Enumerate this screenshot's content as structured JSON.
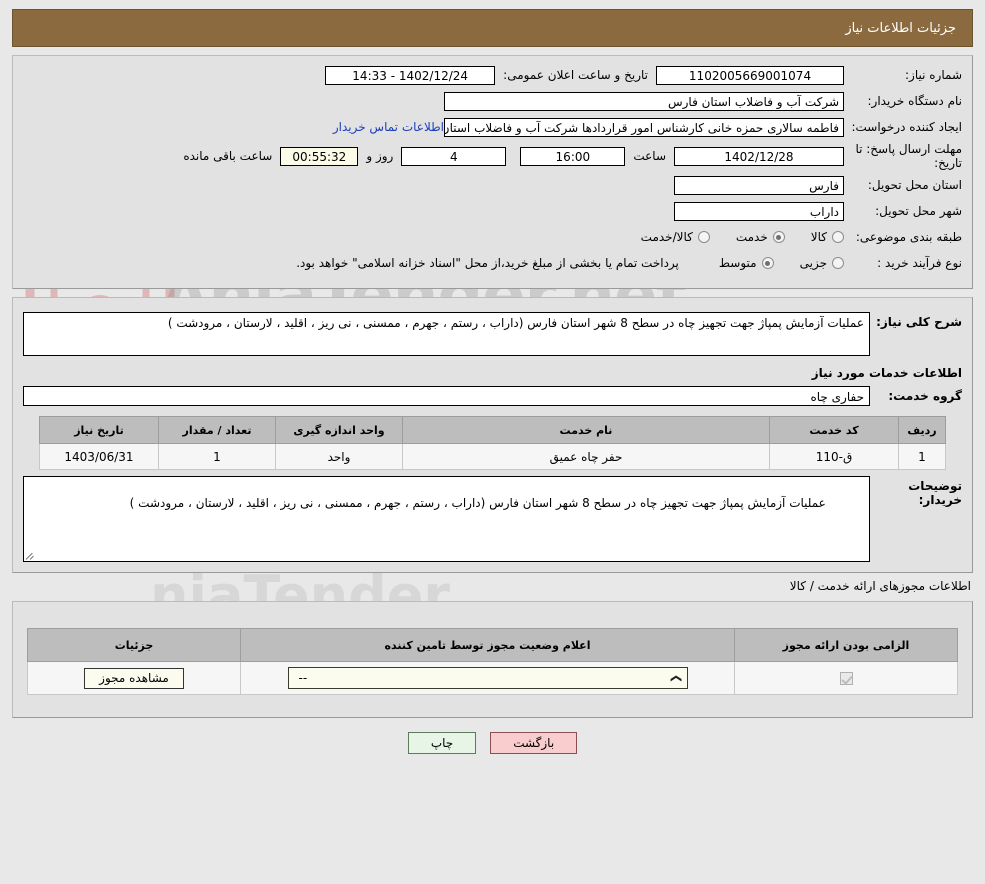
{
  "header": {
    "title": "جزئیات اطلاعات نیاز"
  },
  "main_form": {
    "need_number_label": "شماره نیاز:",
    "need_number_value": "1102005669001074",
    "announce_datetime_label": "تاریخ و ساعت اعلان عمومی:",
    "announce_datetime_value": "1402/12/24 - 14:33",
    "buyer_org_label": "نام دستگاه خریدار:",
    "buyer_org_value": "شرکت آب و فاضلاب استان فارس",
    "requester_label": "ایجاد کننده درخواست:",
    "requester_value": "فاطمه سالاری حمزه خانی کارشناس امور قراردادها شرکت آب و فاضلاب استان ف",
    "buyer_contact_link": "اطلاعات تماس خریدار",
    "deadline_label": "مهلت ارسال پاسخ: تا تاریخ:",
    "deadline_date": "1402/12/28",
    "hour_label": "ساعت",
    "deadline_time": "16:00",
    "days_remaining": "4",
    "days_and_label": "روز و",
    "countdown": "00:55:32",
    "remaining_suffix": "ساعت باقی مانده",
    "province_label": "استان محل تحویل:",
    "province_value": "فارس",
    "city_label": "شهر محل تحویل:",
    "city_value": "داراب",
    "category_label": "طبقه بندی موضوعی:",
    "category_options": [
      {
        "label": "کالا",
        "selected": false
      },
      {
        "label": "خدمت",
        "selected": true
      },
      {
        "label": "کالا/خدمت",
        "selected": false
      }
    ],
    "process_type_label": "نوع فرآیند خرید :",
    "process_type_options": [
      {
        "label": "جزیی",
        "selected": false
      },
      {
        "label": "متوسط",
        "selected": true
      }
    ],
    "payment_note": "پرداخت تمام یا بخشی از مبلغ خرید،از محل \"اسناد خزانه اسلامی\" خواهد بود."
  },
  "need_summary": {
    "label": "شرح کلی نیاز:",
    "text": "عملیات آزمایش پمپاژ جهت تجهیز چاه در سطح 8 شهر استان فارس (داراب ، رستم ، جهرم ، ممسنی ، نی ریز ، اقلید ، لارستان ، مرودشت )"
  },
  "services_section": {
    "heading": "اطلاعات خدمات مورد نیاز",
    "service_group_label": "گروه خدمت:",
    "service_group_value": "حفاری چاه",
    "table": {
      "columns": [
        "ردیف",
        "کد خدمت",
        "نام خدمت",
        "واحد اندازه گیری",
        "تعداد / مقدار",
        "تاریخ نیاز"
      ],
      "rows": [
        {
          "row_no": "1",
          "service_code": "ق-110",
          "service_name": "حفر چاه عمیق",
          "unit": "واحد",
          "quantity": "1",
          "need_date": "1403/06/31"
        }
      ]
    }
  },
  "buyer_notes": {
    "label": "توضیحات خریدار:",
    "text": "عملیات آزمایش پمپاژ جهت تجهیز چاه در سطح 8 شهر استان فارس (داراب ، رستم ، جهرم ، ممسنی ، نی ریز ، اقلید ، لارستان ، مرودشت )"
  },
  "licenses_section": {
    "heading": "اطلاعات مجوزهای ارائه خدمت / کالا",
    "table": {
      "columns": [
        "الزامی بودن ارائه مجوز",
        "اعلام وضعیت مجوز توسط تامین کننده",
        "جزئیات"
      ],
      "rows": [
        {
          "required_checked": true,
          "status_value": "--",
          "details_button": "مشاهده مجوز"
        }
      ]
    }
  },
  "footer": {
    "print_label": "چاپ",
    "back_label": "بازگشت"
  },
  "colors": {
    "banner": "#8a6a3e",
    "link": "#1b3fbb",
    "print_button": "#e6f5e6",
    "back_button": "#f9cdcd",
    "table_header": "#bdbdbd"
  }
}
